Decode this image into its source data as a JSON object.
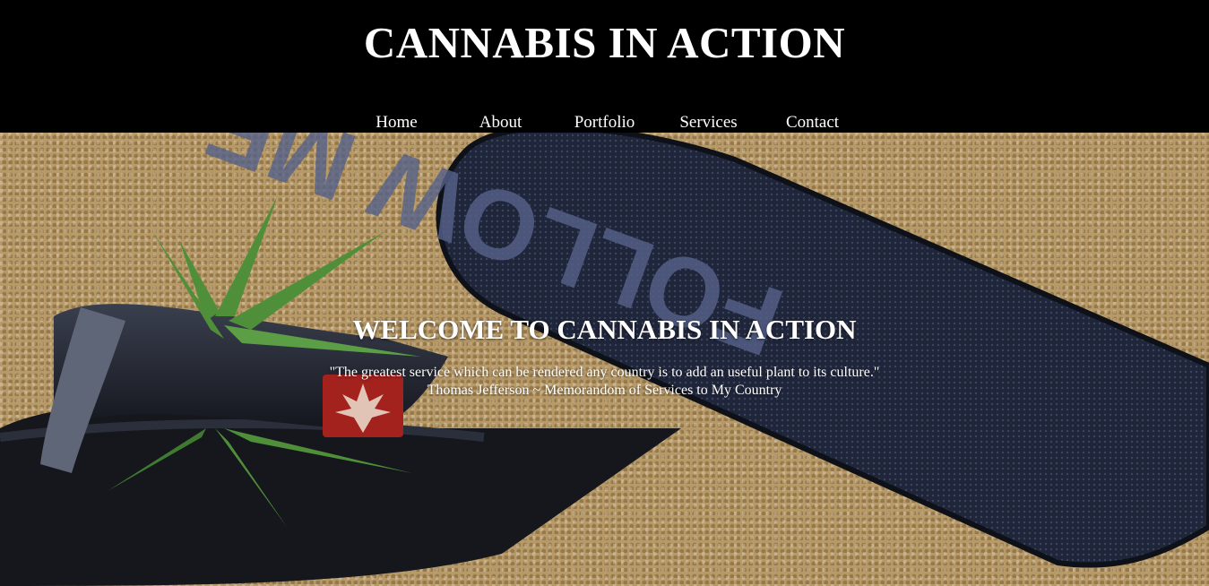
{
  "header": {
    "title": "CANNABIS IN ACTION",
    "nav": [
      "Home",
      "About",
      "Portfolio",
      "Services",
      "Contact"
    ]
  },
  "hero": {
    "heading": "WELCOME TO CANNABIS IN ACTION",
    "quote": "\"The greatest service which can be rendered any country is to add an useful plant to its culture.\"",
    "attribution": "Thomas Jefferson ~ Memorandom of Services to My Country",
    "image": {
      "description_icons": [
        "sandal-photo",
        "cannabis-leaf-icon"
      ],
      "sole_text": "FOLLOW ME",
      "strap_label": "Cannabis leaf logo patch"
    }
  },
  "colors": {
    "header_bg": "#000000",
    "text": "#ffffff",
    "sand": "#b79a68",
    "sandal": "#1e2230",
    "leaf": "#4f8f3a"
  }
}
